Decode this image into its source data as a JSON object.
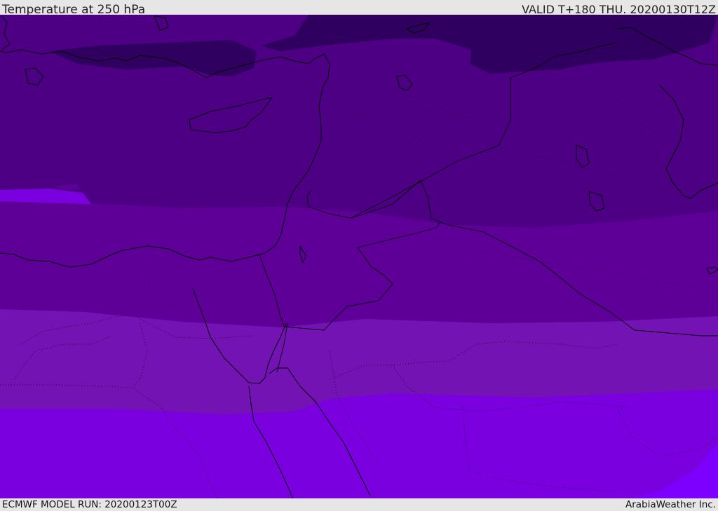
{
  "header": {
    "title": "Temperature at 250 hPa",
    "valid_time": "VALID T+180 THU. 20200130T12Z"
  },
  "footer": {
    "model_run": "ECMWF MODEL RUN: 20200123T00Z",
    "credit": "ArabiaWeather Inc."
  },
  "map": {
    "region": "Eastern Mediterranean and Middle East",
    "field": "temperature",
    "level_hpa": 250,
    "fill_colors": [
      "#2f0060",
      "#4e0084",
      "#5e0098",
      "#7313b3",
      "#7a00e0",
      "#7d00ff"
    ]
  }
}
